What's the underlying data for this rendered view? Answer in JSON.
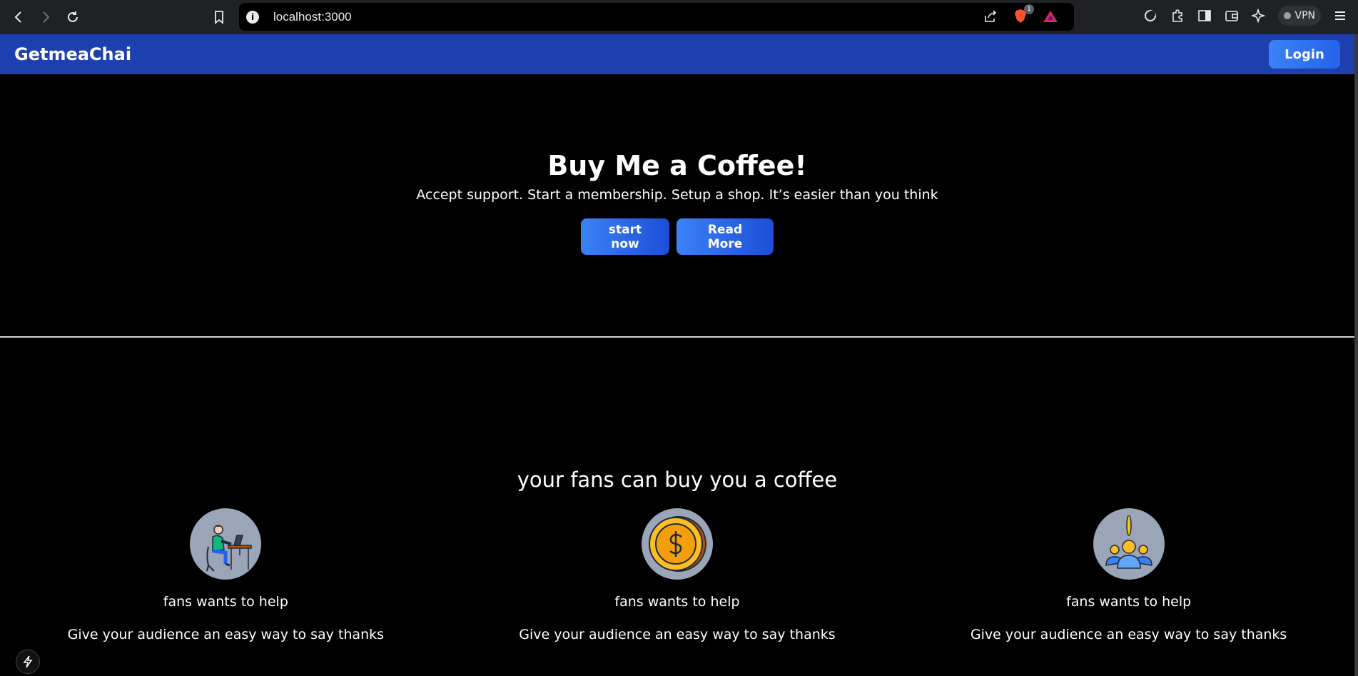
{
  "browser": {
    "url": "localhost:3000",
    "shields_badge": "1",
    "vpn_label": "VPN",
    "icons": [
      "back-icon",
      "forward-icon",
      "reload-icon",
      "bookmark-icon",
      "info-icon",
      "share-icon",
      "brave-shields-icon",
      "brave-rewards-icon",
      "leo-icon",
      "extensions-icon",
      "sidebar-icon",
      "wallet-icon",
      "ai-icon",
      "menu-icon"
    ]
  },
  "navbar": {
    "brand": "GetmeaChai",
    "login_label": "Login",
    "background": "#1e40af"
  },
  "hero": {
    "title": "Buy Me a Coffee!",
    "subtitle": "Accept support. Start a membership. Setup a shop. It’s easier than you think",
    "buttons": [
      {
        "label": "start now"
      },
      {
        "label": "Read More"
      }
    ]
  },
  "features": {
    "heading": "your fans can buy you a coffee",
    "items": [
      {
        "icon": "man-working-icon",
        "title": "fans wants to help",
        "text": "Give your audience an easy way to say thanks"
      },
      {
        "icon": "coin-icon",
        "title": "fans wants to help",
        "text": "Give your audience an easy way to say thanks"
      },
      {
        "icon": "group-icon",
        "title": "fans wants to help",
        "text": "Give your audience an easy way to say thanks"
      }
    ]
  },
  "colors": {
    "accent": "#3b82f6",
    "page_bg": "#000000",
    "icon_circle": "#9aa5b8"
  }
}
